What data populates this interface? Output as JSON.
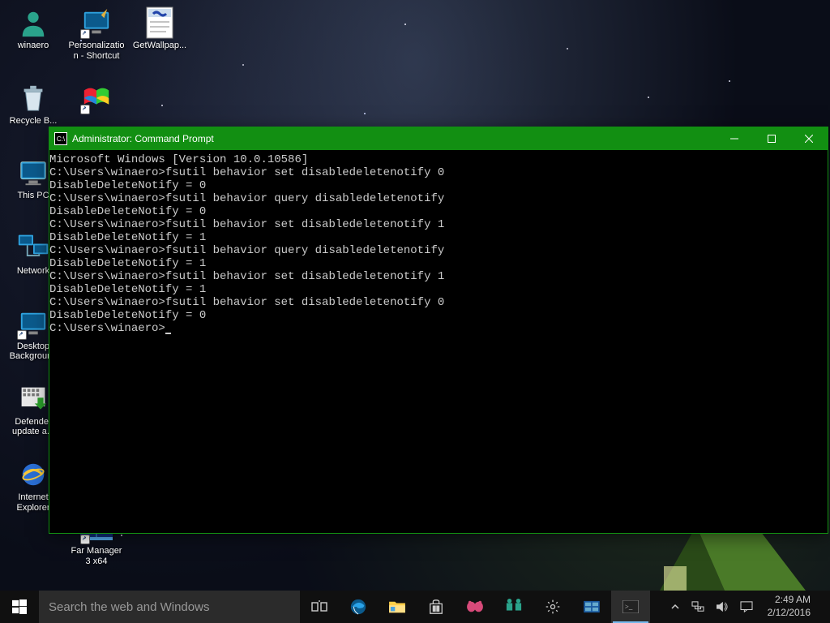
{
  "desktop_icons_col1": [
    {
      "name": "user-folder",
      "label": "winaero"
    },
    {
      "name": "recycle-bin",
      "label": "Recycle B..."
    },
    {
      "name": "this-pc",
      "label": "This PC"
    },
    {
      "name": "network",
      "label": "Network"
    },
    {
      "name": "desktop-background",
      "label": "Desktop Background"
    },
    {
      "name": "defender-update",
      "label": "Defender update a..."
    },
    {
      "name": "internet-explorer",
      "label": "Internet Explorer"
    }
  ],
  "desktop_icons_col2": [
    {
      "name": "personalization-shortcut",
      "label": "Personalization - Shortcut"
    },
    {
      "name": "recycle-bin-ext",
      "label": ""
    },
    {
      "name": "far-manager",
      "label": "Far Manager 3 x64"
    }
  ],
  "desktop_icons_col3": [
    {
      "name": "getwallpaper-script",
      "label": "GetWallpap..."
    }
  ],
  "cmd": {
    "title": "Administrator: Command Prompt",
    "lines": [
      "Microsoft Windows [Version 10.0.10586]",
      "",
      "C:\\Users\\winaero>fsutil behavior set disabledeletenotify 0",
      "DisableDeleteNotify = 0",
      "",
      "C:\\Users\\winaero>fsutil behavior query disabledeletenotify",
      "DisableDeleteNotify = 0",
      "",
      "C:\\Users\\winaero>fsutil behavior set disabledeletenotify 1",
      "DisableDeleteNotify = 1",
      "",
      "C:\\Users\\winaero>fsutil behavior query disabledeletenotify",
      "DisableDeleteNotify = 1",
      "",
      "C:\\Users\\winaero>fsutil behavior set disabledeletenotify 1",
      "DisableDeleteNotify = 1",
      "",
      "C:\\Users\\winaero>fsutil behavior set disabledeletenotify 0",
      "DisableDeleteNotify = 0",
      ""
    ],
    "prompt": "C:\\Users\\winaero>"
  },
  "taskbar": {
    "search_placeholder": "Search the web and Windows",
    "time": "2:49 AM",
    "date": "2/12/2016"
  }
}
